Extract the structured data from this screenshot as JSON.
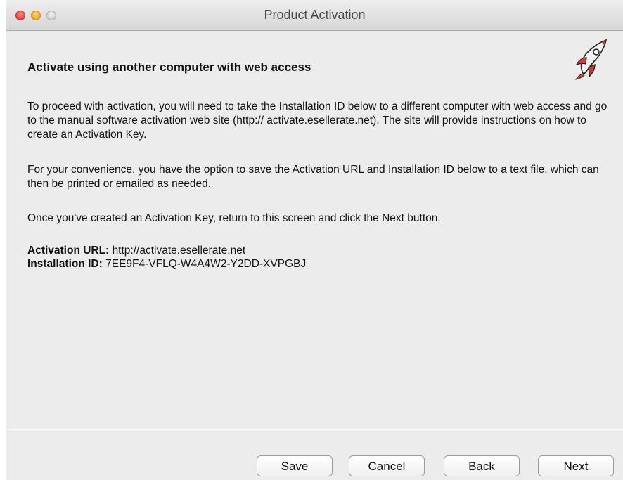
{
  "window": {
    "title": "Product Activation"
  },
  "main": {
    "heading": "Activate using another computer with web access",
    "paragraph1": "To proceed with activation, you will need to take the Installation ID below to a different computer with web access and go to the manual software activation web site (http:// activate.esellerate.net). The site will provide instructions on how to create an Activation Key.",
    "paragraph2": "For your convenience, you have the option to save the Activation URL and Installation ID below to a text file, which can then be printed or emailed as needed.",
    "paragraph3": "Once you've created an Activation Key, return to this screen and click the Next button.",
    "activation_url_label": "Activation URL:",
    "activation_url_value": "http://activate.esellerate.net",
    "installation_id_label": "Installation ID:",
    "installation_id_value": "7EE9F4-VFLQ-W4A4W2-Y2DD-XVPGBJ"
  },
  "buttons": {
    "save": "Save",
    "cancel": "Cancel",
    "back": "Back",
    "next": "Next"
  },
  "icons": {
    "window_close": "close-icon",
    "window_minimize": "minimize-icon",
    "window_zoom": "zoom-icon",
    "logo": "rocket-icon"
  },
  "colors": {
    "close": "#e0443e",
    "minimize": "#e5a72a",
    "zoom": "#cfcfcf",
    "window_bg": "#ececec"
  }
}
